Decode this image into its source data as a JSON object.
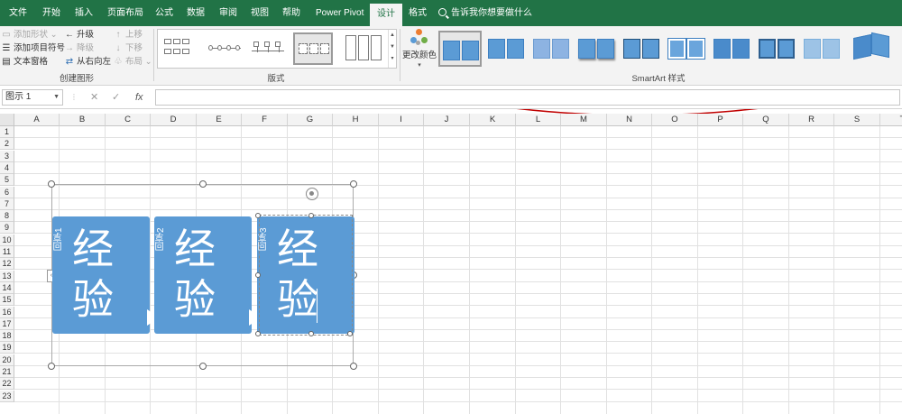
{
  "tabs": [
    {
      "label": "文件"
    },
    {
      "label": "开始"
    },
    {
      "label": "插入"
    },
    {
      "label": "页面布局"
    },
    {
      "label": "公式"
    },
    {
      "label": "数据"
    },
    {
      "label": "审阅"
    },
    {
      "label": "视图"
    },
    {
      "label": "帮助"
    },
    {
      "label": "Power Pivot"
    },
    {
      "label": "设计",
      "active": true
    },
    {
      "label": "格式"
    }
  ],
  "tell_me": "告诉我你想要做什么",
  "create_graphic": {
    "add_shape": "添加形状",
    "add_bullet": "添加项目符号",
    "text_pane": "文本窗格",
    "promote": "升级",
    "demote": "降级",
    "right_to_left": "从右向左",
    "move_up": "上移",
    "move_down": "下移",
    "layout": "布局",
    "label": "创建图形"
  },
  "layouts_label": "版式",
  "change_colors": "更改颜色",
  "smartart_styles_label": "SmartArt 样式",
  "name_box": "图示 1",
  "formula_icons": {
    "cancel": "✕",
    "enter": "✓",
    "fx": "fx"
  },
  "columns": [
    "A",
    "B",
    "C",
    "D",
    "E",
    "F",
    "G",
    "H",
    "I",
    "J",
    "K",
    "L",
    "M",
    "N",
    "O",
    "P",
    "Q",
    "R",
    "S",
    "T"
  ],
  "rows": [
    "1",
    "2",
    "3",
    "4",
    "5",
    "6",
    "7",
    "8",
    "9",
    "10",
    "11",
    "12",
    "13",
    "14",
    "15",
    "16",
    "17",
    "18",
    "19",
    "20",
    "21",
    "22",
    "23"
  ],
  "smartart": {
    "cards": [
      {
        "title": "回享1",
        "body": "经验"
      },
      {
        "title": "回享2",
        "body": "经验"
      },
      {
        "title": "回享3",
        "body": "经验"
      }
    ]
  },
  "colors": {
    "ribbon_tab_bg": "#217346",
    "shape_fill": "#5b9bd5",
    "annotation": "#c00000"
  }
}
